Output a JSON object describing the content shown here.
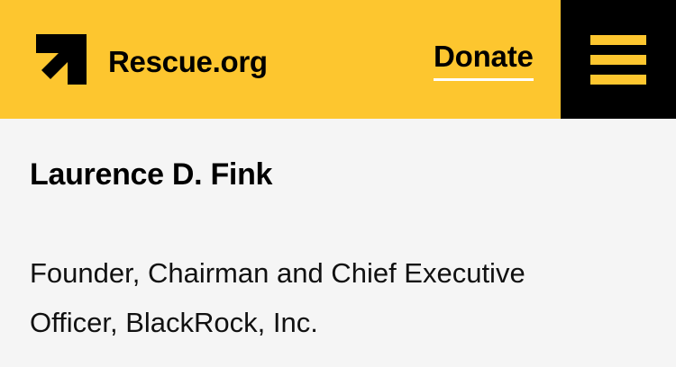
{
  "header": {
    "logo_text": "Rescue.org",
    "logo_icon": "irc-arrow-logo-icon",
    "donate_label": "Donate",
    "menu_icon": "hamburger-menu-icon",
    "colors": {
      "brand_yellow": "#fdc62f",
      "black": "#000000",
      "underline": "#ffffff"
    }
  },
  "profile": {
    "name": "Laurence D. Fink",
    "title": "Founder, Chairman and Chief Executive Officer, BlackRock, Inc."
  },
  "page": {
    "background": "#f5f5f5"
  }
}
